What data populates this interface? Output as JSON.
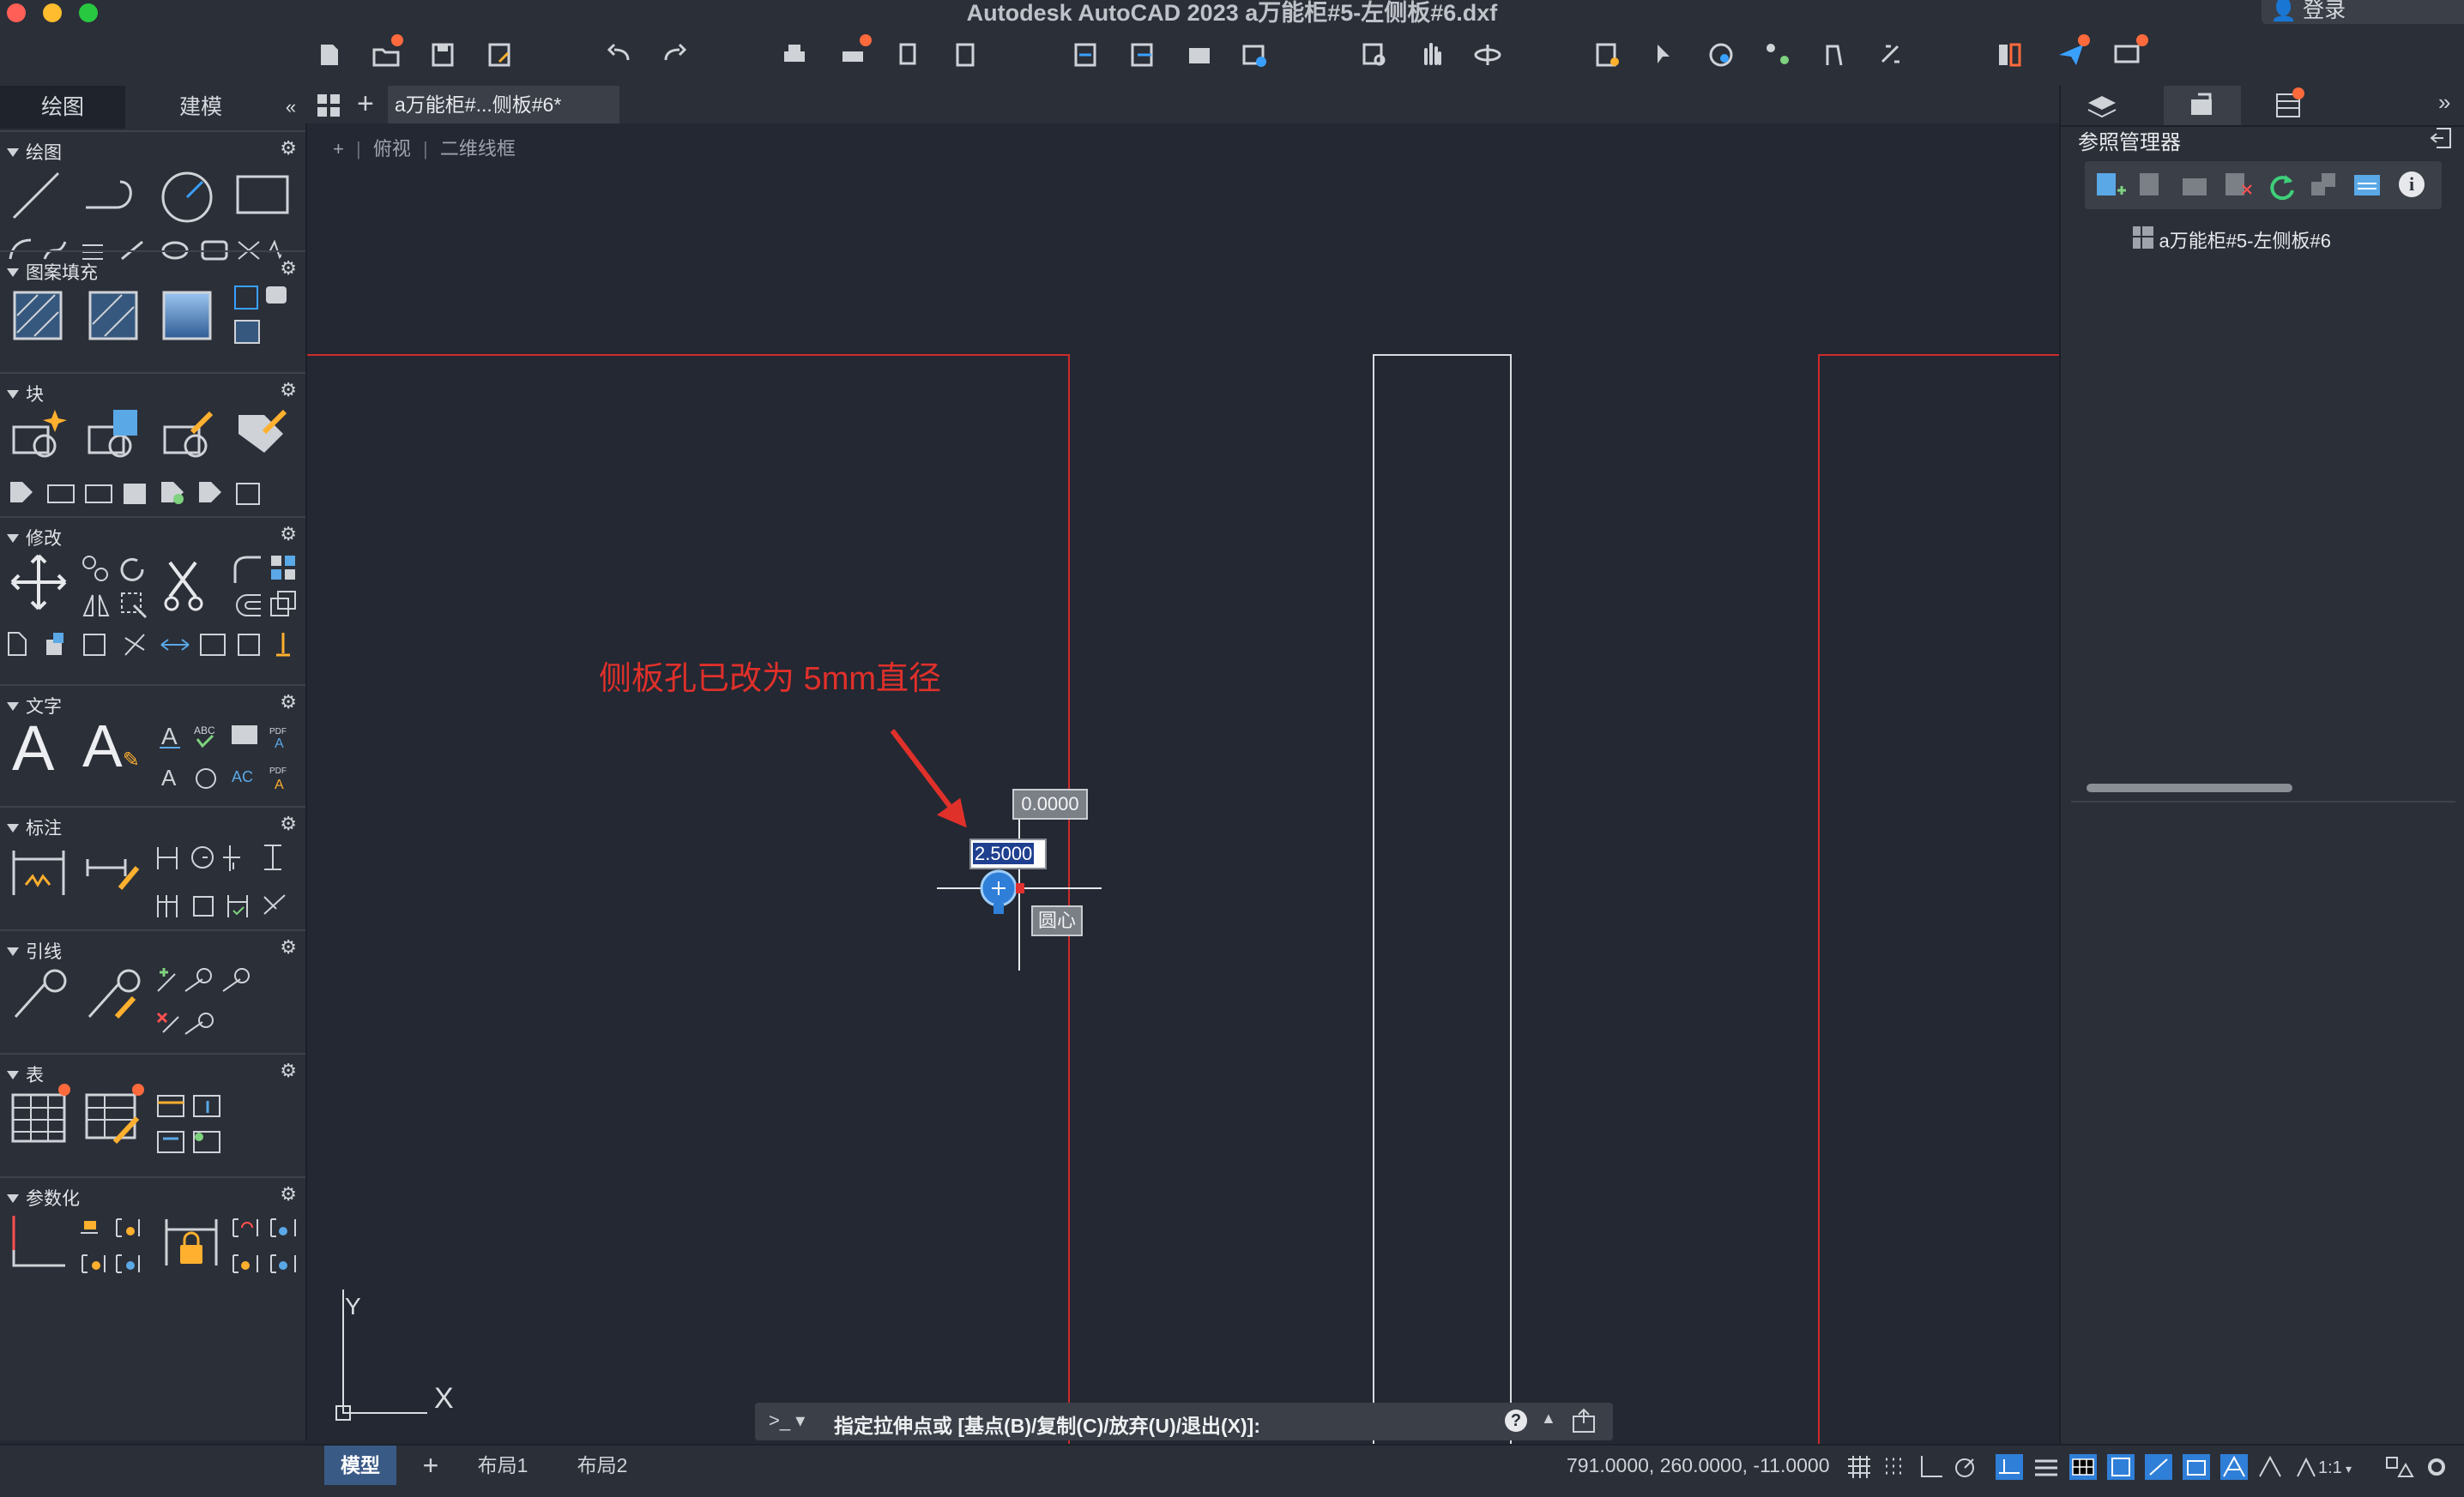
{
  "window": {
    "title": "Autodesk AutoCAD 2023    a万能柜#5-左侧板#6.dxf",
    "login_label": "登录"
  },
  "palette": {
    "tabs": [
      "绘图",
      "建模"
    ],
    "collapse_icon": "double-chevron-left",
    "sections": [
      "绘图",
      "图案填充",
      "块",
      "修改",
      "文字",
      "标注",
      "引线",
      "表",
      "参数化"
    ]
  },
  "document": {
    "tab_label": "a万能柜#...侧板#6*",
    "viewport_label_plus": "+",
    "viewport_view": "俯视",
    "viewport_style": "二维线框"
  },
  "canvas": {
    "annotation": "侧板孔已改为 5mm直径",
    "annotation_color": "#e0302a",
    "dynamic_input_top": "0.0000",
    "dynamic_input_active": "2.5000",
    "snap_tooltip": "圆心",
    "ucs_x": "X",
    "ucs_y": "Y"
  },
  "command": {
    "prompt_icon": ">_",
    "text": "指定拉伸点或 [基点(B)/复制(C)/放弃(U)/退出(X)]:"
  },
  "ref_manager": {
    "title": "参照管理器",
    "item": "a万能柜#5-左侧板#6"
  },
  "status": {
    "tabs": [
      "模型",
      "布局1",
      "布局2"
    ],
    "coordinates": "791.0000, 260.0000, -11.0000",
    "scale": "1:1"
  },
  "colors": {
    "background": "#232833",
    "panel": "#2b2f38",
    "accent_blue": "#2f7fd8",
    "red_line": "#cf2a2a"
  }
}
